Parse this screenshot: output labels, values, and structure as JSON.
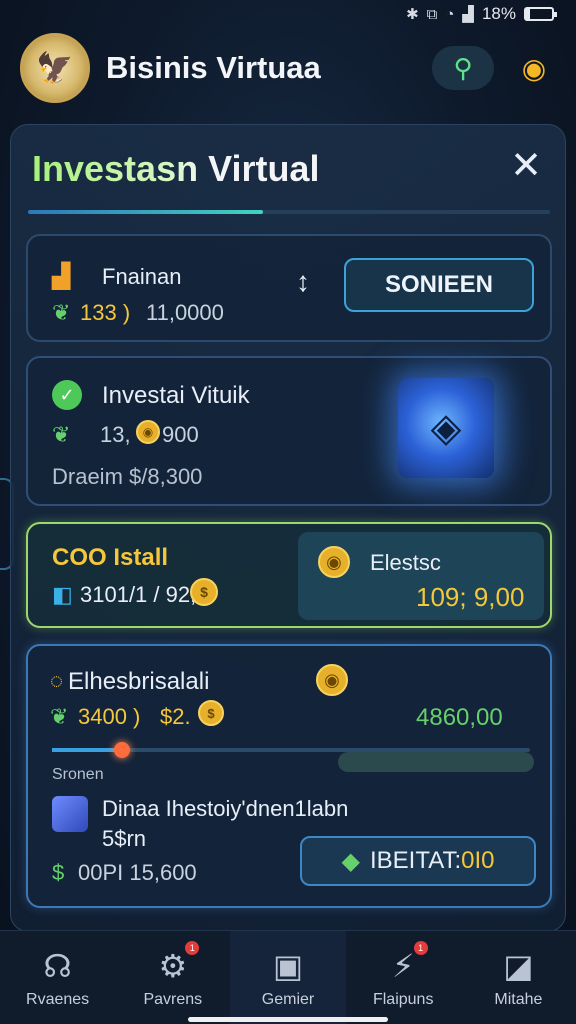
{
  "status": {
    "battery": "18%",
    "icons": [
      "bluetooth-icon",
      "vibrate-icon",
      "wifi-icon",
      "signal-icon"
    ]
  },
  "app": {
    "title": "Bisinis Virtuaa"
  },
  "panel": {
    "title": "Investasn Virtual",
    "progress": 0.45
  },
  "card1": {
    "label": "Fnainan",
    "value_green": "133 )",
    "value": "11,0000",
    "button": "SONIEEN",
    "arrow": "↕"
  },
  "card2": {
    "title": "Investai Vituik",
    "amount": "13, ",
    "amount2": "900",
    "footer": "Draeim $/8,300"
  },
  "card3": {
    "title": "COO Istall",
    "left_value": "3101/1 / 92,",
    "right_label": "Elestsc",
    "right_value": "109; 9,00"
  },
  "card4": {
    "title": "Elhesbrisalali",
    "value_green": "3400 )",
    "value_yellow": "$2.",
    "right_value": "4860,00",
    "slider_label": "Sronen",
    "item_title": "Dinaa Ihestoiy'dnen1labn",
    "item_sub": "5$rn",
    "footer_value": "00PI 15,600",
    "button": "IBEITAT:",
    "button_accent": "0I0"
  },
  "nav": [
    {
      "label": "Rvaenes",
      "icon": "headset-icon"
    },
    {
      "label": "Pavrens",
      "icon": "gear-icon",
      "badge": true
    },
    {
      "label": "Gemier",
      "icon": "building-icon"
    },
    {
      "label": "Flaipuns",
      "icon": "bolt-icon",
      "badge": true
    },
    {
      "label": "Mitahe",
      "icon": "chart-icon"
    }
  ],
  "colors": {
    "accent": "#43d3c1",
    "green": "#66d06c",
    "gold": "#f5c73a"
  }
}
